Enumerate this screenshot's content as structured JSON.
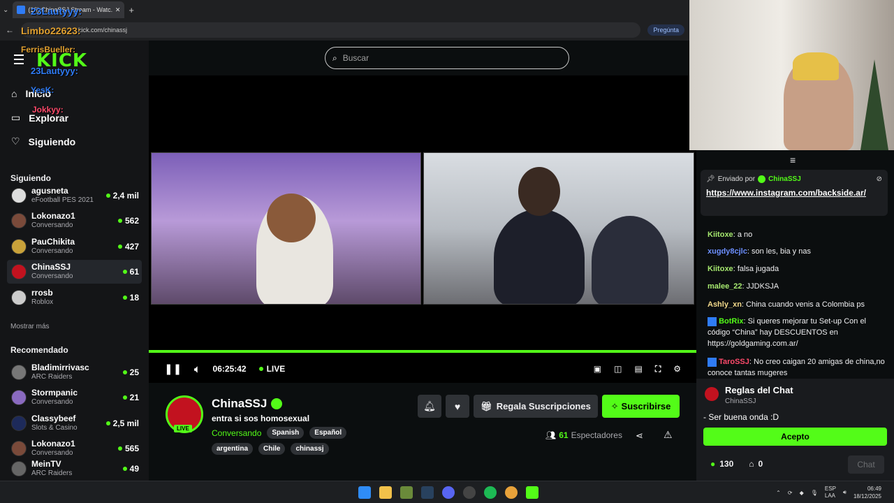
{
  "browser": {
    "tab_title": "(16) ChinaSSJ Stream - Watc...",
    "url": "kick.com/chinassj",
    "ask_label": "Pregúnta"
  },
  "overlay_names": [
    "23Lautyyy:",
    "Limbo22623:",
    "FerrisBueller:",
    "23Lautyyy:",
    "YesK:",
    "Jokkyy:"
  ],
  "sidebar": {
    "logo": "KICK",
    "nav": [
      {
        "label": "Inicio",
        "icon": "home-icon"
      },
      {
        "label": "Explorar",
        "icon": "browse-icon"
      },
      {
        "label": "Siguiendo",
        "icon": "heart-icon"
      }
    ],
    "following_header": "Siguiendo",
    "following": [
      {
        "name": "agusneta",
        "category": "eFootball PES 2021",
        "viewers": "2,4 mil"
      },
      {
        "name": "Lokonazo1",
        "category": "Conversando",
        "viewers": "562"
      },
      {
        "name": "PauChikita",
        "category": "Conversando",
        "viewers": "427"
      },
      {
        "name": "ChinaSSJ",
        "category": "Conversando",
        "viewers": "61"
      },
      {
        "name": "rrosb",
        "category": "Roblox",
        "viewers": "18"
      }
    ],
    "show_more": "Mostrar más",
    "recommended_header": "Recomendado",
    "recommended": [
      {
        "name": "Bladimirrivasc",
        "category": "ARC Raiders",
        "viewers": "25"
      },
      {
        "name": "Stormpanic",
        "category": "Conversando",
        "viewers": "21"
      },
      {
        "name": "Classybeef",
        "category": "Slots & Casino",
        "viewers": "2,5 mil"
      },
      {
        "name": "Lokonazo1",
        "category": "Conversando",
        "viewers": "565"
      },
      {
        "name": "MeinTV",
        "category": "ARC Raiders",
        "viewers": "49"
      }
    ]
  },
  "search": {
    "placeholder": "Buscar"
  },
  "player": {
    "time": "06:25:42",
    "live_label": "LIVE"
  },
  "channel": {
    "name": "ChinaSSJ",
    "title": "entra si sos homosexual",
    "category": "Conversando",
    "languages": [
      "Spanish",
      "Español"
    ],
    "tags": [
      "argentina",
      "Chile",
      "chinassj"
    ],
    "live_badge": "LIVE",
    "gift_label": "Regala Suscripciones",
    "subscribe_label": "Suscribirse",
    "viewer_count": "61",
    "viewer_label": "Espectadores"
  },
  "chat": {
    "pinned_prefix": "Enviado por",
    "pinned_user": "ChinaSSJ",
    "pinned_link": "https://www.instagram.com/backside.ar/",
    "messages": [
      {
        "user": "Kiitoxe",
        "color": "#a6e86f",
        "text": "a no"
      },
      {
        "user": "xugdy8cjlc",
        "color": "#6c8fff",
        "text": "son les, bia y nas"
      },
      {
        "user": "Kiitoxe",
        "color": "#a6e86f",
        "text": "falsa jugada"
      },
      {
        "user": "malee_22",
        "color": "#a6e86f",
        "text": "JJDKSJA"
      },
      {
        "user": "Ashly_xn",
        "color": "#f2d98b",
        "text": "China cuando venis a Colombia ps"
      },
      {
        "user": "BotRix",
        "color": "#53fc18",
        "text": "Si queres mejorar tu Set-up Con el código “China” hay DESCUENTOS en https://goldgaming.com.ar/"
      },
      {
        "user": "TaroSSJ",
        "color": "#ff4a6b",
        "text": "No creo caigan 20 amigas de china,no conoce tantas mugeres"
      }
    ],
    "rules_title": "Reglas del Chat",
    "rules_user": "ChinaSSJ",
    "rules_text": "- Ser buena onda :D",
    "accept_label": "Acepto",
    "points": "130",
    "store_count": "0",
    "chat_button": "Chat"
  },
  "taskbar": {
    "lang": "ESP",
    "lang2": "LAA",
    "time": "06:49",
    "date": "18/12/2025"
  },
  "colors": {
    "accent": "#53fc18",
    "background": "#0b0e0f",
    "sidebar": "#141517"
  }
}
